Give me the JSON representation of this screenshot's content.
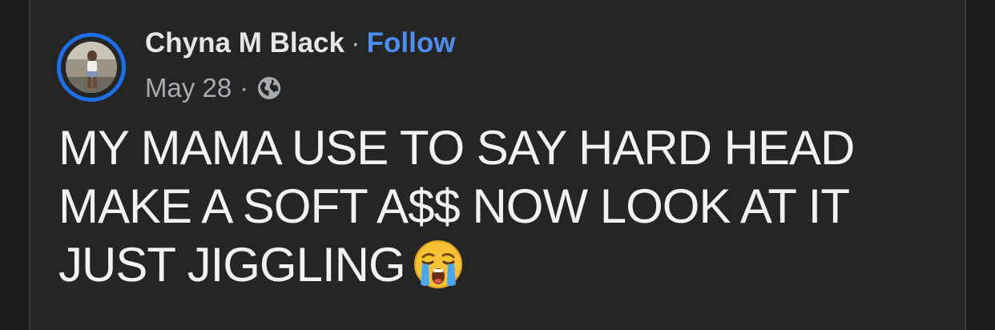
{
  "post": {
    "author": "Chyna M Black",
    "separator": "·",
    "follow_label": "Follow",
    "date": "May 28",
    "date_separator": "·",
    "privacy_icon": "globe-icon",
    "text_line_1": "MY MAMA USE TO SAY HARD HEAD",
    "text_line_2": "MAKE A SOFT A$$ NOW LOOK AT IT",
    "text_line_3": "JUST JIGGLING",
    "emoji": "loudly-crying-face-emoji"
  },
  "colors": {
    "background": "#252526",
    "story_ring": "#1d6fe8",
    "follow_link": "#4d8df0",
    "primary_text": "#f2f2f2",
    "secondary_text": "#a8abaf"
  }
}
